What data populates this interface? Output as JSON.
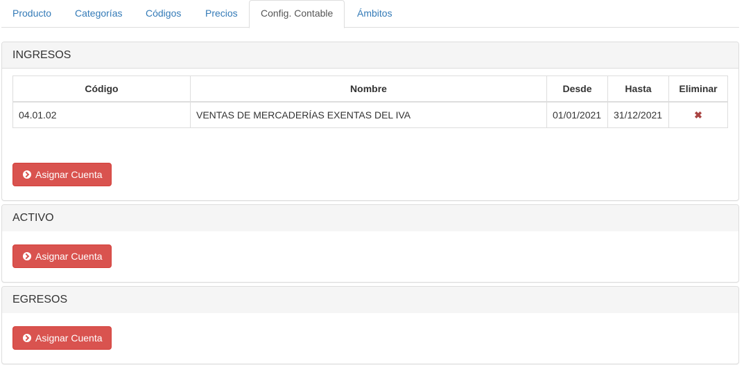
{
  "tabs": [
    {
      "label": "Producto"
    },
    {
      "label": "Categorías"
    },
    {
      "label": "Códigos"
    },
    {
      "label": "Precios"
    },
    {
      "label": "Config. Contable"
    },
    {
      "label": "Ámbitos"
    }
  ],
  "active_tab": "Config. Contable",
  "ingresos": {
    "title": "INGRESOS",
    "columns": [
      "Código",
      "Nombre",
      "Desde",
      "Hasta",
      "Eliminar"
    ],
    "rows": [
      {
        "codigo": "04.01.02",
        "nombre": "VENTAS DE MERCADERÍAS EXENTAS DEL IVA",
        "desde": "01/01/2021",
        "hasta": "31/12/2021",
        "delete_icon": "✖"
      }
    ],
    "button_label": "Asignar Cuenta"
  },
  "activo": {
    "title": "ACTIVO",
    "button_label": "Asignar Cuenta"
  },
  "egresos": {
    "title": "EGRESOS",
    "button_label": "Asignar Cuenta"
  },
  "icons": {
    "button_icon": "chevron-circle-right-icon",
    "delete_icon": "close-icon"
  },
  "colors": {
    "link": "#337ab7",
    "danger": "#d9534f",
    "delete": "#a94442"
  }
}
